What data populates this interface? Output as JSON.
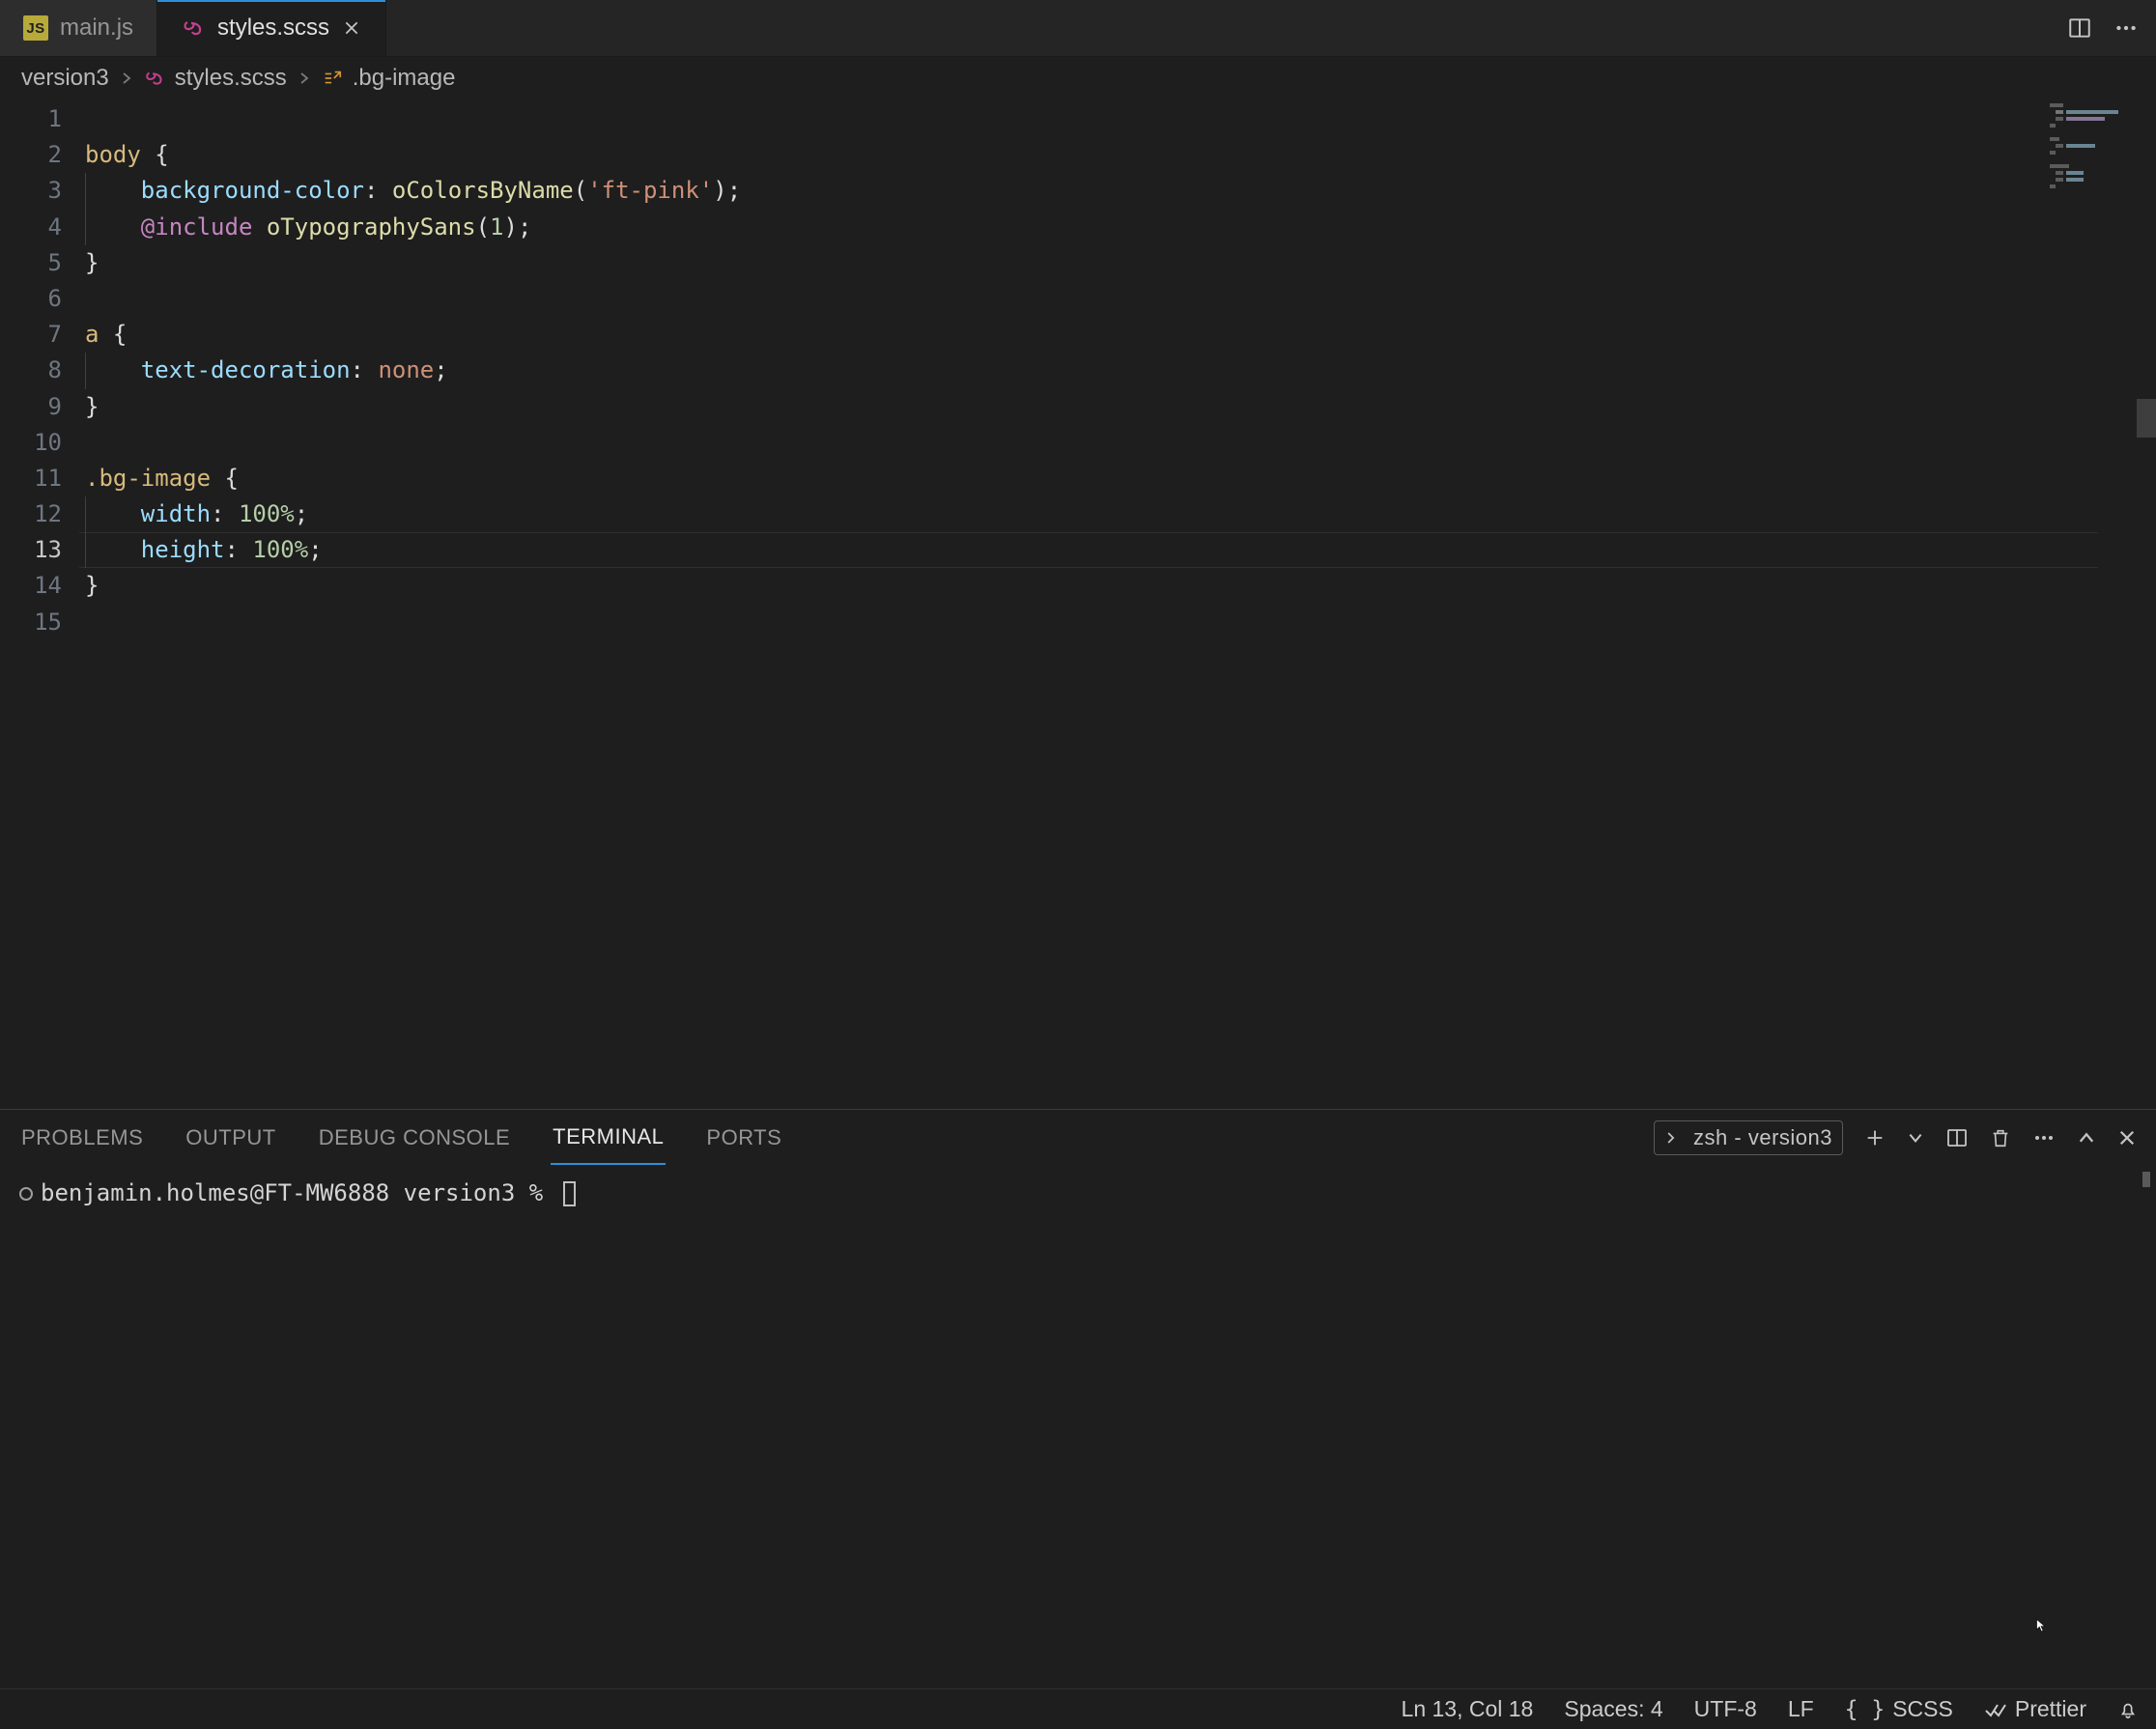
{
  "tabs": [
    {
      "id": "main-js",
      "label": "main.js",
      "icon": "JS",
      "active": false
    },
    {
      "id": "styles-scss",
      "label": "styles.scss",
      "icon": "scss",
      "active": true
    }
  ],
  "breadcrumb": {
    "folder": "version3",
    "file": "styles.scss",
    "symbol": ".bg-image"
  },
  "editor": {
    "line_count": 15,
    "current_line": 13,
    "lines": [
      {
        "n": 1,
        "tokens": []
      },
      {
        "n": 2,
        "tokens": [
          {
            "t": "body",
            "c": "t-sel"
          },
          {
            "t": " ",
            "c": ""
          },
          {
            "t": "{",
            "c": "t-punc"
          }
        ]
      },
      {
        "n": 3,
        "indent": 1,
        "tokens": [
          {
            "t": "background-color",
            "c": "t-prop"
          },
          {
            "t": ": ",
            "c": "t-punc"
          },
          {
            "t": "oColorsByName",
            "c": "t-func"
          },
          {
            "t": "(",
            "c": "t-punc"
          },
          {
            "t": "'ft-pink'",
            "c": "t-str"
          },
          {
            "t": ")",
            "c": "t-punc"
          },
          {
            "t": ";",
            "c": "t-semi"
          }
        ]
      },
      {
        "n": 4,
        "indent": 1,
        "tokens": [
          {
            "t": "@include",
            "c": "t-at"
          },
          {
            "t": " ",
            "c": ""
          },
          {
            "t": "oTypographySans",
            "c": "t-func"
          },
          {
            "t": "(",
            "c": "t-punc"
          },
          {
            "t": "1",
            "c": "t-num"
          },
          {
            "t": ")",
            "c": "t-punc"
          },
          {
            "t": ";",
            "c": "t-semi"
          }
        ]
      },
      {
        "n": 5,
        "tokens": [
          {
            "t": "}",
            "c": "t-punc"
          }
        ]
      },
      {
        "n": 6,
        "tokens": []
      },
      {
        "n": 7,
        "tokens": [
          {
            "t": "a",
            "c": "t-sel"
          },
          {
            "t": " ",
            "c": ""
          },
          {
            "t": "{",
            "c": "t-punc"
          }
        ]
      },
      {
        "n": 8,
        "indent": 1,
        "tokens": [
          {
            "t": "text-decoration",
            "c": "t-prop"
          },
          {
            "t": ": ",
            "c": "t-punc"
          },
          {
            "t": "none",
            "c": "t-val"
          },
          {
            "t": ";",
            "c": "t-semi"
          }
        ]
      },
      {
        "n": 9,
        "tokens": [
          {
            "t": "}",
            "c": "t-punc"
          }
        ]
      },
      {
        "n": 10,
        "tokens": []
      },
      {
        "n": 11,
        "tokens": [
          {
            "t": ".bg-image",
            "c": "t-sel"
          },
          {
            "t": " ",
            "c": ""
          },
          {
            "t": "{",
            "c": "t-punc"
          }
        ]
      },
      {
        "n": 12,
        "indent": 1,
        "tokens": [
          {
            "t": "width",
            "c": "t-prop"
          },
          {
            "t": ": ",
            "c": "t-punc"
          },
          {
            "t": "100%",
            "c": "t-num"
          },
          {
            "t": ";",
            "c": "t-semi"
          }
        ]
      },
      {
        "n": 13,
        "indent": 1,
        "tokens": [
          {
            "t": "height",
            "c": "t-prop"
          },
          {
            "t": ": ",
            "c": "t-punc"
          },
          {
            "t": "100%",
            "c": "t-num"
          },
          {
            "t": ";",
            "c": "t-semi"
          }
        ]
      },
      {
        "n": 14,
        "tokens": [
          {
            "t": "}",
            "c": "t-punc"
          }
        ]
      },
      {
        "n": 15,
        "tokens": []
      }
    ]
  },
  "panel": {
    "tabs": [
      "PROBLEMS",
      "OUTPUT",
      "DEBUG CONSOLE",
      "TERMINAL",
      "PORTS"
    ],
    "active_tab": "TERMINAL",
    "terminal_label": "zsh - version3",
    "prompt": "benjamin.holmes@FT-MW6888 version3 % "
  },
  "statusbar": {
    "cursor": "Ln 13, Col 18",
    "spaces": "Spaces: 4",
    "encoding": "UTF-8",
    "eol": "LF",
    "lang": "SCSS",
    "formatter": "Prettier"
  }
}
